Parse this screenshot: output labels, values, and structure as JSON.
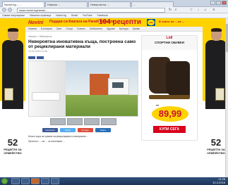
{
  "browser": {
    "tabs": [
      {
        "label": "Novini.bg - ..."
      },
      {
        "label": "Новини ..."
      },
      {
        "label": "Невероятна ..."
      },
      {
        "label": "..."
      }
    ],
    "url": "www.novini.bg/news/..."
  },
  "bookmarks": [
    "Самые популярные",
    "Начална страница",
    "Novini.bg",
    "Gmail",
    "YouTube",
    "Facebook"
  ],
  "site": {
    "logo": "Novini",
    "promo_text": "Подари си Книгата на Рачиб Шишков",
    "promo_count": "104 рецепти",
    "lidl_label": "LIDL",
    "side_text": "В чиито на ... на ...",
    "menu": [
      "Новини",
      "България",
      "Свят",
      "Спорт",
      "Бизнес",
      "Любопитно",
      "Здраве",
      "Култура",
      "Крими"
    ]
  },
  "article": {
    "breadcrumb": "Начало › Любопитно",
    "title": "Невероятна иновативна къща, построена само от рециклирани материали",
    "meta": "10.03.2016 11:26",
    "social": [
      {
        "label": "Facebook",
        "color": "#3b5998"
      },
      {
        "label": "Twitter",
        "color": "#55acee"
      },
      {
        "label": "Google+",
        "color": "#dd4b39"
      },
      {
        "label": "Share",
        "color": "#2a6fb8"
      }
    ],
    "paragraphs": [
      "Много хора са чували за рециклирането материали ...",
      "Проектът ... на ... се използват ..."
    ]
  },
  "ad": {
    "brand": "Lidl",
    "title": "СПОРТНИ ОБУВКИ",
    "price_old": "...",
    "price": "89,99",
    "cta": "КУПИ СЕГА"
  },
  "left_promo": {
    "number": "52",
    "label": "РЕЦЕПТИ ЗА СЕМЕЙСТВО"
  },
  "right_promo": {
    "number": "52",
    "label": "РЕЦЕПТИ ЗА СЕМЕЙСТВО"
  },
  "taskbar": {
    "apps": [
      "explorer",
      "ie",
      "firefox",
      "chrome",
      "media"
    ],
    "time": "11:28",
    "date": "10.3.2016"
  }
}
